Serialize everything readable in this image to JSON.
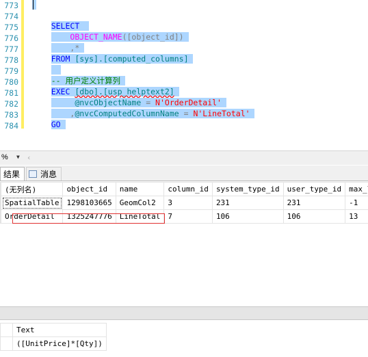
{
  "editor": {
    "line_numbers": [
      "773",
      "774",
      "775",
      "776",
      "777",
      "778",
      "779",
      "780",
      "781",
      "782",
      "783",
      "784"
    ],
    "lines": {
      "l774": "SELECT",
      "l775_fn": "OBJECT_NAME",
      "l775_args": "([object_id])",
      "l776_pre": ",",
      "l776_star": "*",
      "l777_kw": "FROM",
      "l777_rest": "[sys].[computed_columns]",
      "l779": "-- 用户定义计算列",
      "l780_kw": "EXEC",
      "l780_proc": "[dbo].[usp_helptext2]",
      "l781_var": "@nvcObjectName",
      "l781_eq": " = ",
      "l781_str": "N'OrderDetail'",
      "l782_comma": ",",
      "l782_var": "@nvcComputedColumnName",
      "l782_eq": " = ",
      "l782_str": "N'LineTotal'",
      "l783": "GO"
    }
  },
  "zoombar": {
    "zoom": "%"
  },
  "tabs": {
    "results": "结果",
    "messages": "消息"
  },
  "grid1": {
    "columns": [
      "(无列名)",
      "object_id",
      "name",
      "column_id",
      "system_type_id",
      "user_type_id",
      "max_l"
    ],
    "rows": [
      [
        "SpatialTable",
        "1298103665",
        "GeomCol2",
        "3",
        "231",
        "231",
        "-1"
      ],
      [
        "OrderDetail",
        "1325247776",
        "LineTotal",
        "7",
        "106",
        "106",
        "13"
      ]
    ]
  },
  "grid2": {
    "columns": [
      "Text"
    ],
    "rows": [
      [
        "([UnitPrice]*[Qty])"
      ]
    ]
  },
  "colors": {
    "selection": "#add6ff",
    "keyword": "#0000ff",
    "function": "#ff00ff",
    "string": "#ff0000",
    "comment": "#008000",
    "highlight_box": "#e03030"
  }
}
